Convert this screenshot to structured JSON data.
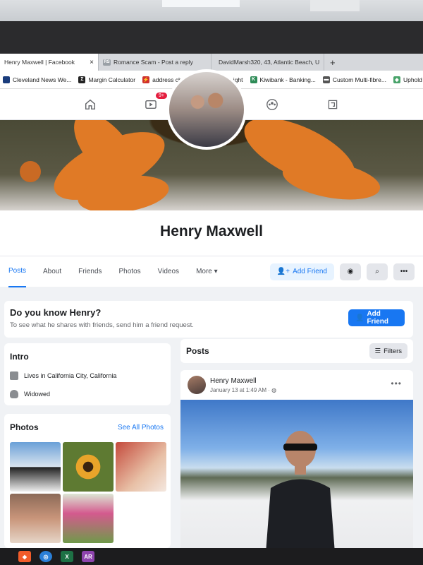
{
  "browser": {
    "tabs": [
      {
        "label": "Henry Maxwell | Facebook",
        "favicon": "facebook-icon",
        "close": "×"
      },
      {
        "label": "Romance Scam - Post a reply",
        "favicon": "RS"
      },
      {
        "label": "DavidMarsh320, 43, Atlantic Beach, U",
        "favicon": "site-icon"
      }
    ],
    "new_tab": "+",
    "bookmarks": [
      "Cleveland News We...",
      "Margin Calculator",
      "address checker",
      "Mainfreight",
      "Kiwibank - Banking...",
      "Custom Multi-fibre...",
      "Uphold"
    ]
  },
  "fb_nav": {
    "badge": "9+",
    "icons": [
      "home-icon",
      "watch-icon",
      "marketplace-icon",
      "groups-icon",
      "gaming-icon"
    ]
  },
  "profile": {
    "name": "Henry Maxwell",
    "tabs": [
      "Posts",
      "About",
      "Friends",
      "Photos",
      "Videos",
      "More ▾"
    ],
    "add_friend": "Add Friend"
  },
  "know": {
    "title": "Do you know Henry?",
    "subtitle": "To see what he shares with friends, send him a friend request.",
    "button": "Add Friend"
  },
  "intro": {
    "title": "Intro",
    "lives_prefix": "Lives in ",
    "lives_city": "California City, California",
    "status": "Widowed"
  },
  "photos": {
    "title": "Photos",
    "see_all": "See All Photos"
  },
  "posts": {
    "title": "Posts",
    "filters": "Filters",
    "author": "Henry Maxwell",
    "time": "January 13 at 1:49 AM · ",
    "more": "•••"
  },
  "taskbar": {
    "apps": [
      "AR"
    ]
  },
  "colors": {
    "accent": "#1877f2",
    "badge": "#e41e3f"
  }
}
